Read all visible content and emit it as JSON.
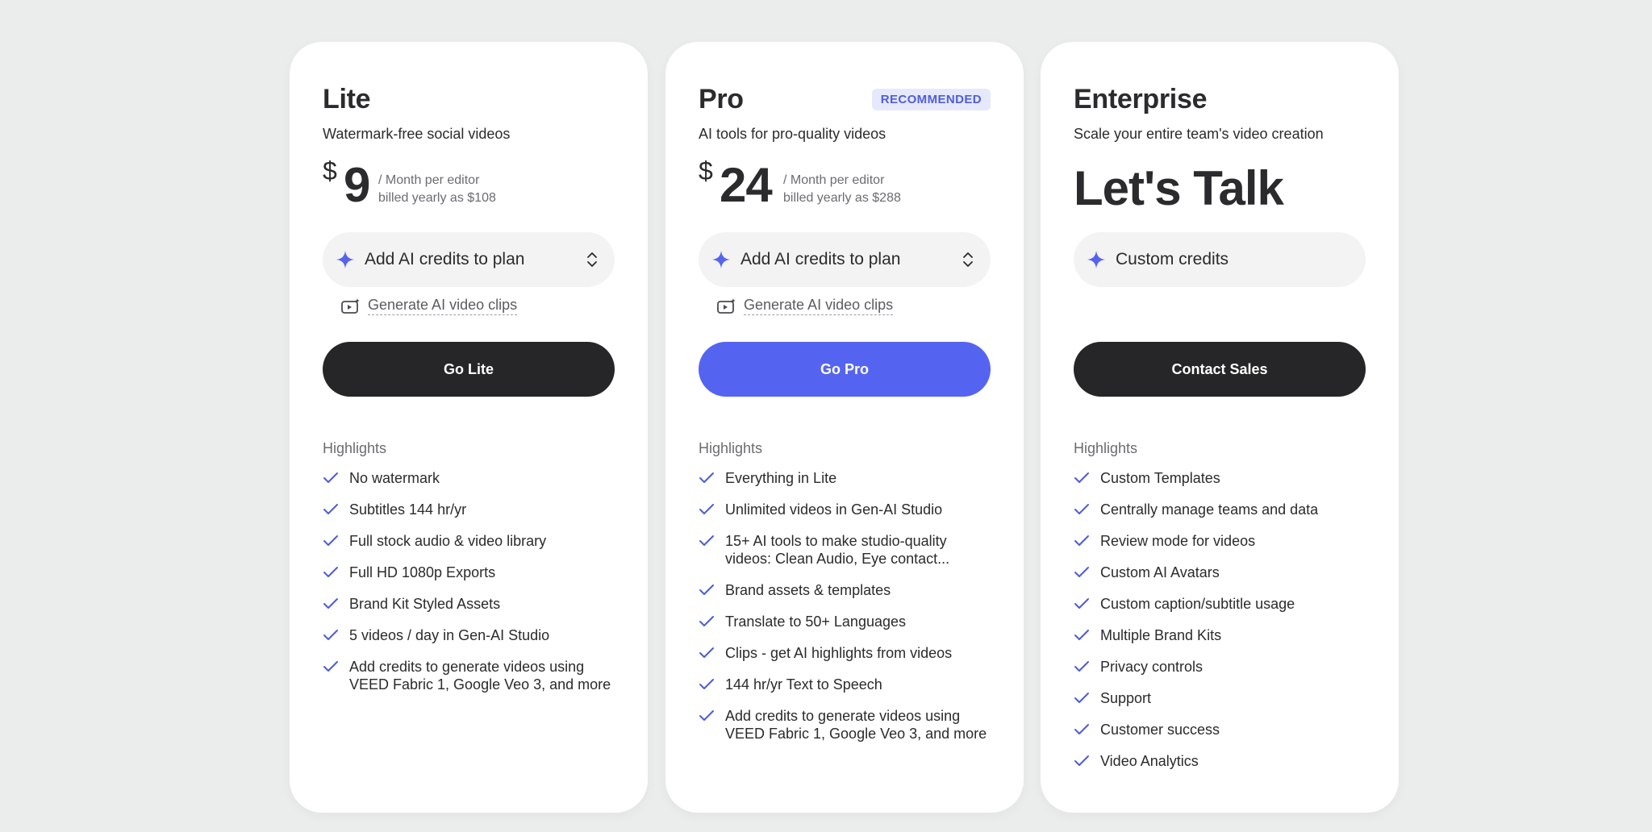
{
  "colors": {
    "background": "#ebecec",
    "card": "#ffffff",
    "accent": "#5564f0",
    "dark_button": "#262628",
    "badge_bg": "#e6e8fb",
    "badge_text": "#4f5ed8",
    "check": "#4d5bd8"
  },
  "plans": [
    {
      "name": "Lite",
      "tagline": "Watermark-free social videos",
      "currency": "$",
      "price": "9",
      "period_line1": "/ Month per editor",
      "period_line2": "billed yearly as $108",
      "credits_label": "Add AI credits to plan",
      "credits_icon": "sparkle-icon",
      "has_dropdown": true,
      "generate_link": "Generate AI video clips",
      "cta_label": "Go Lite",
      "highlights_title": "Highlights",
      "features": [
        "No watermark",
        "Subtitles 144 hr/yr",
        "Full stock audio & video library",
        "Full HD 1080p Exports",
        "Brand Kit Styled Assets",
        "5 videos / day in Gen-AI Studio",
        "Add credits to generate videos using VEED Fabric 1, Google Veo 3, and more"
      ]
    },
    {
      "name": "Pro",
      "badge": "RECOMMENDED",
      "tagline": "AI tools for pro-quality videos",
      "currency": "$",
      "price": "24",
      "period_line1": "/ Month per editor",
      "period_line2": "billed yearly as $288",
      "credits_label": "Add AI credits to plan",
      "credits_icon": "sparkle-icon",
      "has_dropdown": true,
      "generate_link": "Generate AI video clips",
      "cta_label": "Go Pro",
      "highlights_title": "Highlights",
      "features": [
        "Everything in Lite",
        "Unlimited videos in Gen-AI Studio",
        "15+ AI tools to make studio-quality videos: Clean Audio, Eye contact...",
        "Brand assets & templates",
        "Translate to 50+ Languages",
        "Clips - get AI highlights from videos",
        "144 hr/yr Text to Speech",
        "Add credits to generate videos using VEED Fabric 1, Google Veo 3, and more"
      ]
    },
    {
      "name": "Enterprise",
      "tagline": "Scale your entire team's video creation",
      "price_text": "Let's Talk",
      "credits_label": "Custom credits",
      "credits_icon": "sparkle-icon",
      "has_dropdown": false,
      "cta_label": "Contact Sales",
      "highlights_title": "Highlights",
      "features": [
        "Custom Templates",
        "Centrally manage teams and data",
        "Review mode for videos",
        "Custom AI Avatars",
        "Custom caption/subtitle usage",
        "Multiple Brand Kits",
        "Privacy controls",
        "Support",
        "Customer success",
        "Video Analytics"
      ]
    }
  ]
}
